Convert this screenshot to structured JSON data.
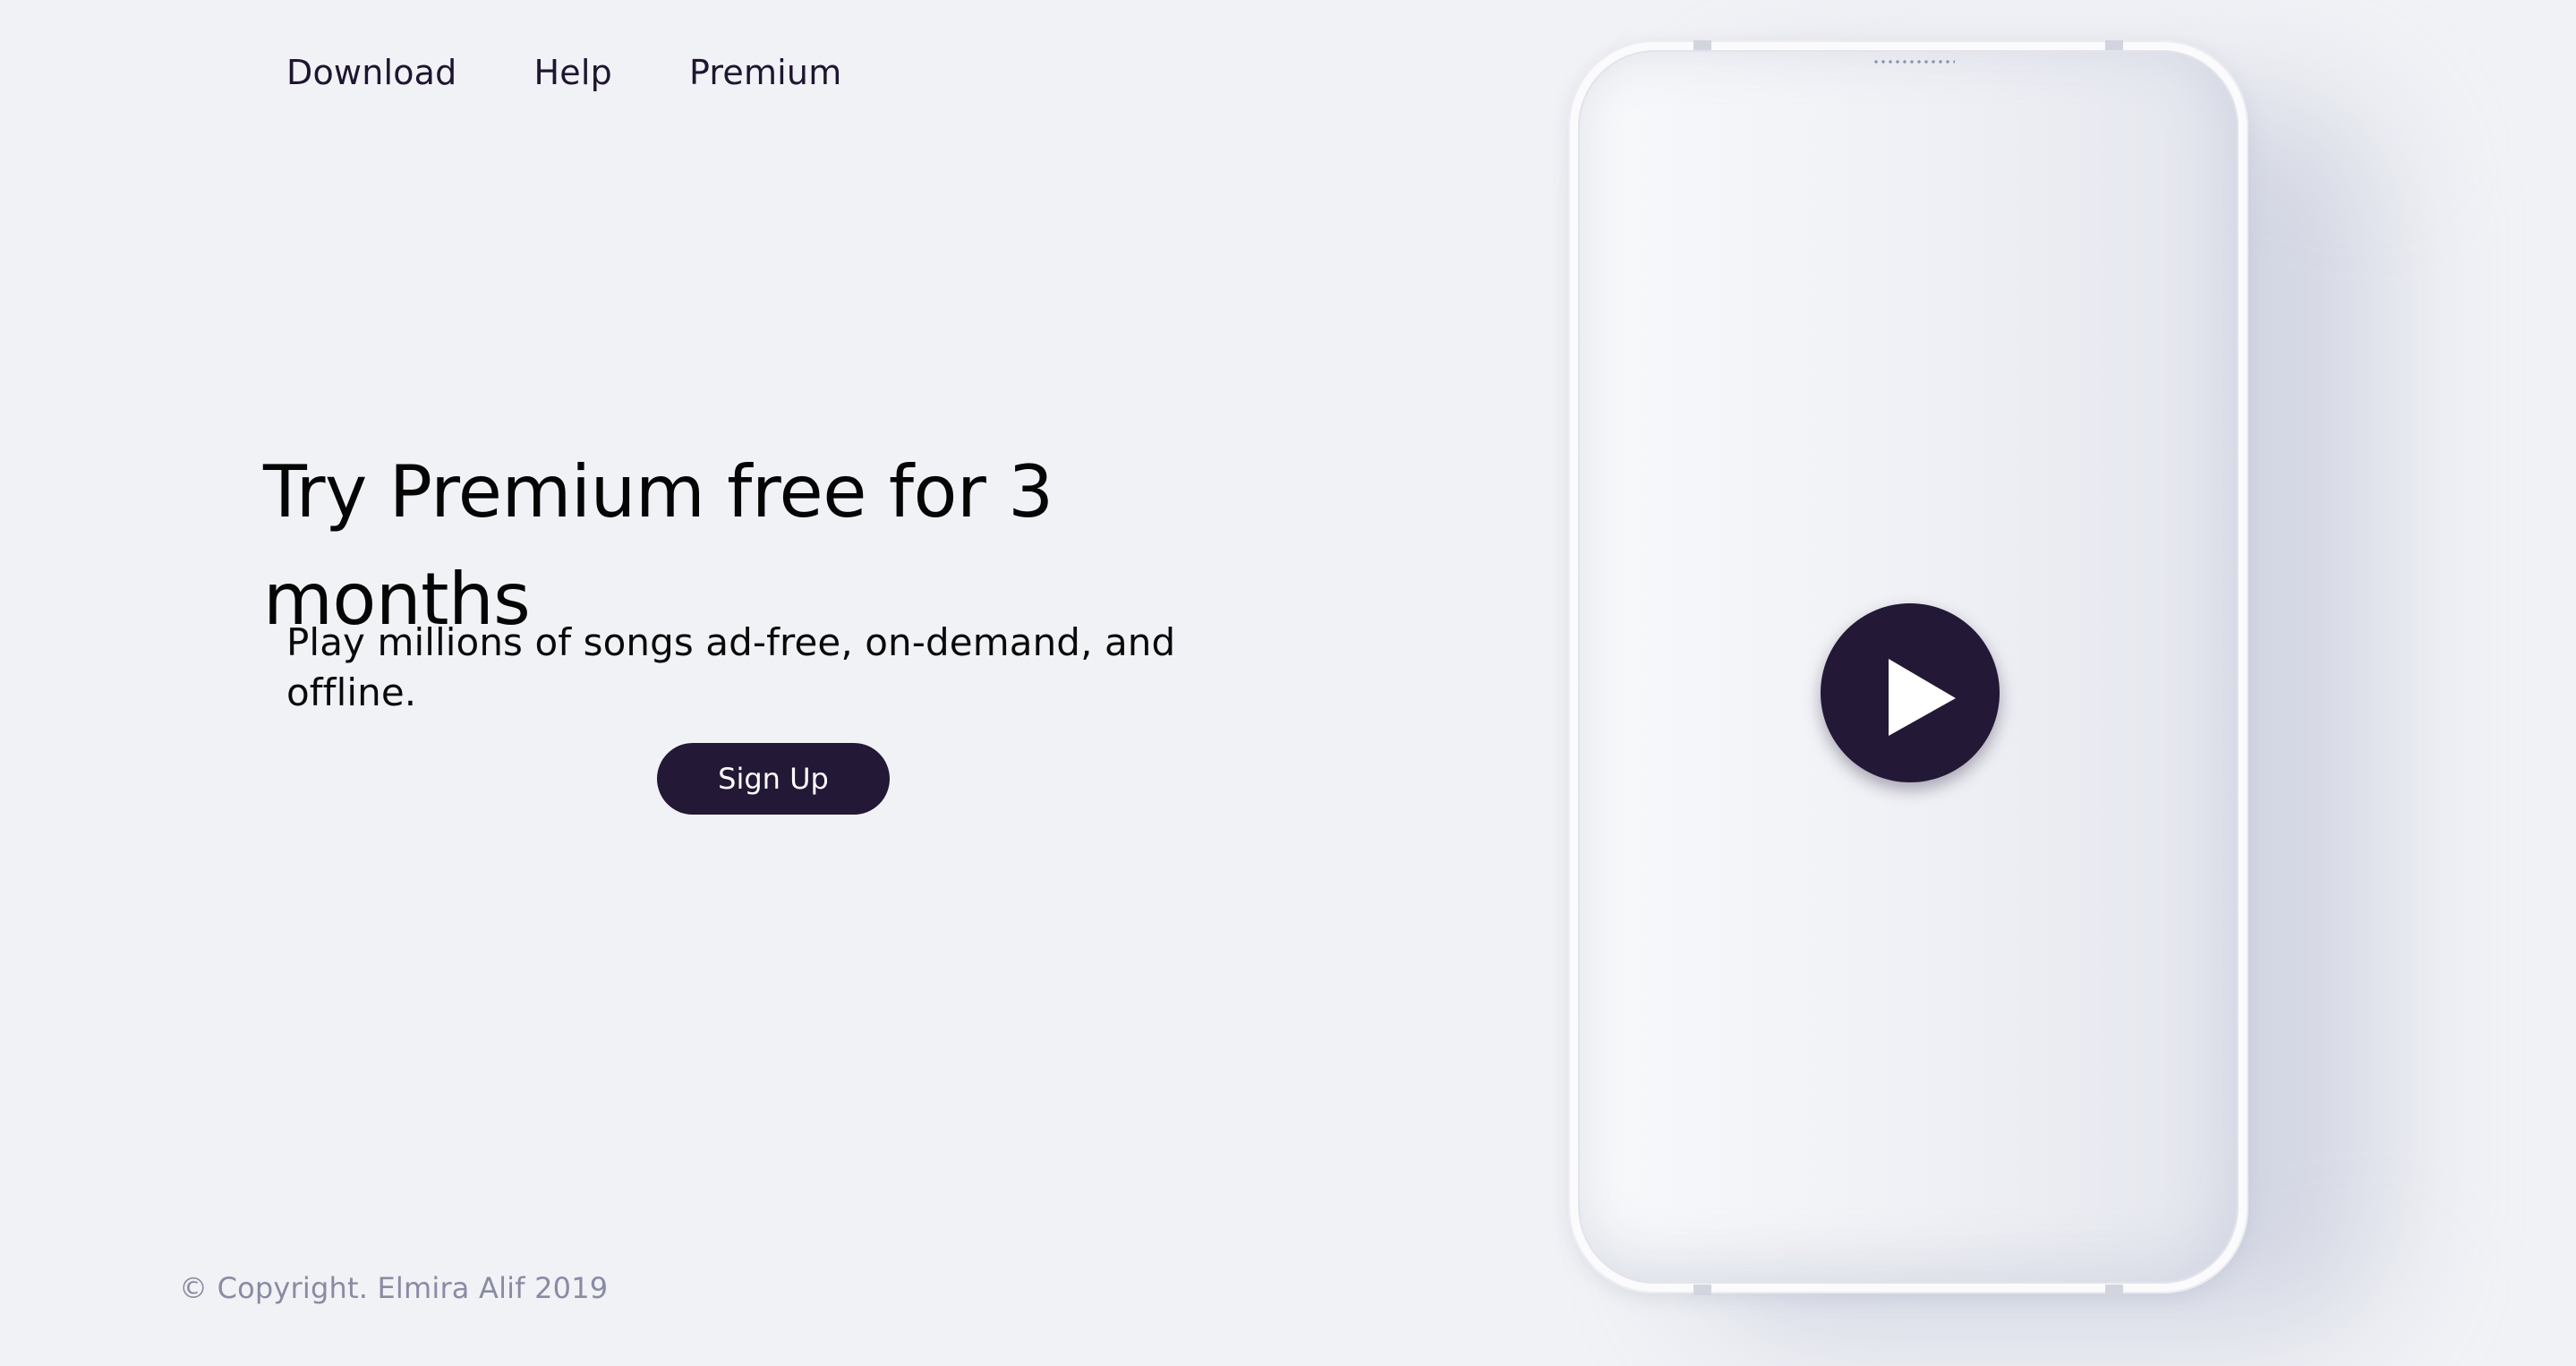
{
  "nav": {
    "items": [
      {
        "label": "Download"
      },
      {
        "label": "Help"
      },
      {
        "label": "Premium"
      }
    ]
  },
  "hero": {
    "title": "Try Premium free for 3 months",
    "subtitle": "Play millions of songs ad-free, on-demand, and offline.",
    "signup_label": "Sign Up"
  },
  "footer": {
    "copyright": "© Copyright. Elmira Alif 2019"
  },
  "phone": {
    "play_icon": "play-icon"
  },
  "colors": {
    "background": "#f1f2f6",
    "accent": "#231836",
    "footer_text": "#8a8ba3"
  }
}
